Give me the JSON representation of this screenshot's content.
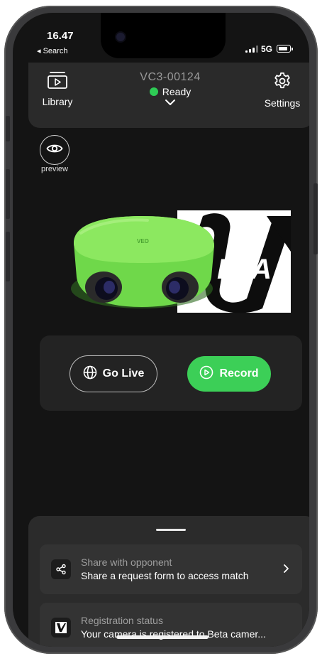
{
  "status_bar": {
    "time": "16.47",
    "back_label": "◂ Search",
    "network": "5G"
  },
  "header": {
    "library_label": "Library",
    "settings_label": "Settings",
    "device_id": "VC3-00124",
    "device_status": "Ready",
    "status_color": "#2ecc55"
  },
  "preview": {
    "label": "preview"
  },
  "hero": {
    "camera_logo_text": "VEO",
    "beta_logo_text": "ETA"
  },
  "actions": {
    "go_live_label": "Go Live",
    "record_label": "Record",
    "record_color": "#3ccf57"
  },
  "sheet": {
    "rows": [
      {
        "title": "Share with opponent",
        "subtitle": "Share a request form to access match"
      },
      {
        "title": "Registration status",
        "subtitle": "Your camera is registered to Beta camer..."
      }
    ]
  }
}
